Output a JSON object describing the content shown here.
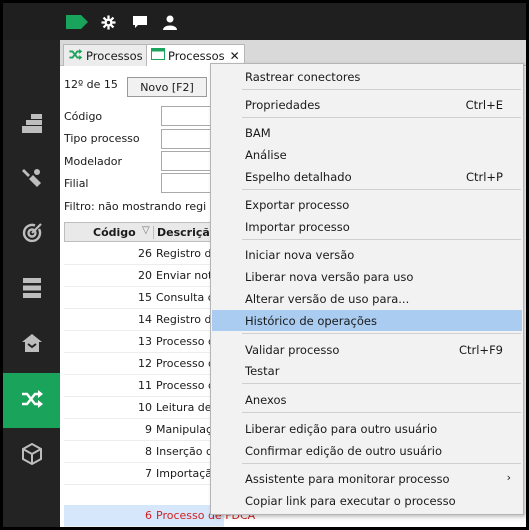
{
  "colors": {
    "brand_green": "#1aa35a",
    "topbar": "#1f1f1f",
    "sidebar": "#232323",
    "highlight": "#a9ccf0",
    "selected_row_text": "#d32020"
  },
  "topbar": {
    "icons": [
      "tag-icon",
      "gear-icon",
      "chat-icon",
      "user-icon"
    ]
  },
  "sidebar": {
    "items": [
      "dashboard-icon",
      "tools-icon",
      "target-icon",
      "server-icon",
      "home-icon",
      "shuffle-icon",
      "cube-icon"
    ],
    "active": "shuffle-icon"
  },
  "tabs": [
    {
      "label": "Processos",
      "icon": "shuffle-icon",
      "closable": false
    },
    {
      "label": "Processos",
      "icon": "window-icon",
      "closable": true,
      "close_label": "✕"
    }
  ],
  "record_counter": "12º de 15",
  "new_button": "Novo [F2]",
  "form": {
    "labels": [
      "Código",
      "Tipo processo",
      "Modelador",
      "Filial"
    ]
  },
  "filter_text": "Filtro: não mostrando regi",
  "grid": {
    "headers": {
      "codigo": "Código",
      "sort": "▽",
      "descricao": "Descrição"
    },
    "rows": [
      {
        "code": "26",
        "desc": "Registro de"
      },
      {
        "code": "20",
        "desc": "Enviar notif"
      },
      {
        "code": "15",
        "desc": "Consulta de"
      },
      {
        "code": "14",
        "desc": "Registro de"
      },
      {
        "code": "13",
        "desc": "Processo de"
      },
      {
        "code": "12",
        "desc": "Processo de"
      },
      {
        "code": "11",
        "desc": "Processo de"
      },
      {
        "code": "10",
        "desc": "Leitura de d"
      },
      {
        "code": "9",
        "desc": "Manipulaçã"
      },
      {
        "code": "8",
        "desc": "Inserção de"
      },
      {
        "code": "7",
        "desc": "Importação"
      },
      {
        "code": "6",
        "desc": "Processo de FDCA"
      }
    ]
  },
  "context_menu": {
    "items": [
      {
        "label": "Rastrear conectores",
        "shortcut": ""
      },
      {
        "label": "Propriedades",
        "shortcut": "Ctrl+E"
      },
      {
        "label": "BAM",
        "shortcut": ""
      },
      {
        "label": "Análise",
        "shortcut": ""
      },
      {
        "label": "Espelho detalhado",
        "shortcut": "Ctrl+P"
      },
      {
        "label": "Exportar processo",
        "shortcut": ""
      },
      {
        "label": "Importar processo",
        "shortcut": ""
      },
      {
        "label": "Iniciar nova versão",
        "shortcut": ""
      },
      {
        "label": "Liberar nova versão para uso",
        "shortcut": ""
      },
      {
        "label": "Alterar versão de uso para...",
        "shortcut": ""
      },
      {
        "label": "Histórico de operações",
        "shortcut": ""
      },
      {
        "label": "Validar processo",
        "shortcut": "Ctrl+F9"
      },
      {
        "label": "Testar",
        "shortcut": ""
      },
      {
        "label": "Anexos",
        "shortcut": ""
      },
      {
        "label": "Liberar edição para outro usuário",
        "shortcut": ""
      },
      {
        "label": "Confirmar edição de outro usuário",
        "shortcut": ""
      },
      {
        "label": "Assistente para monitorar processo",
        "shortcut": "",
        "arrow": "›"
      },
      {
        "label": "Copiar link para executar o processo",
        "shortcut": ""
      }
    ],
    "highlighted": "Histórico de operações"
  }
}
